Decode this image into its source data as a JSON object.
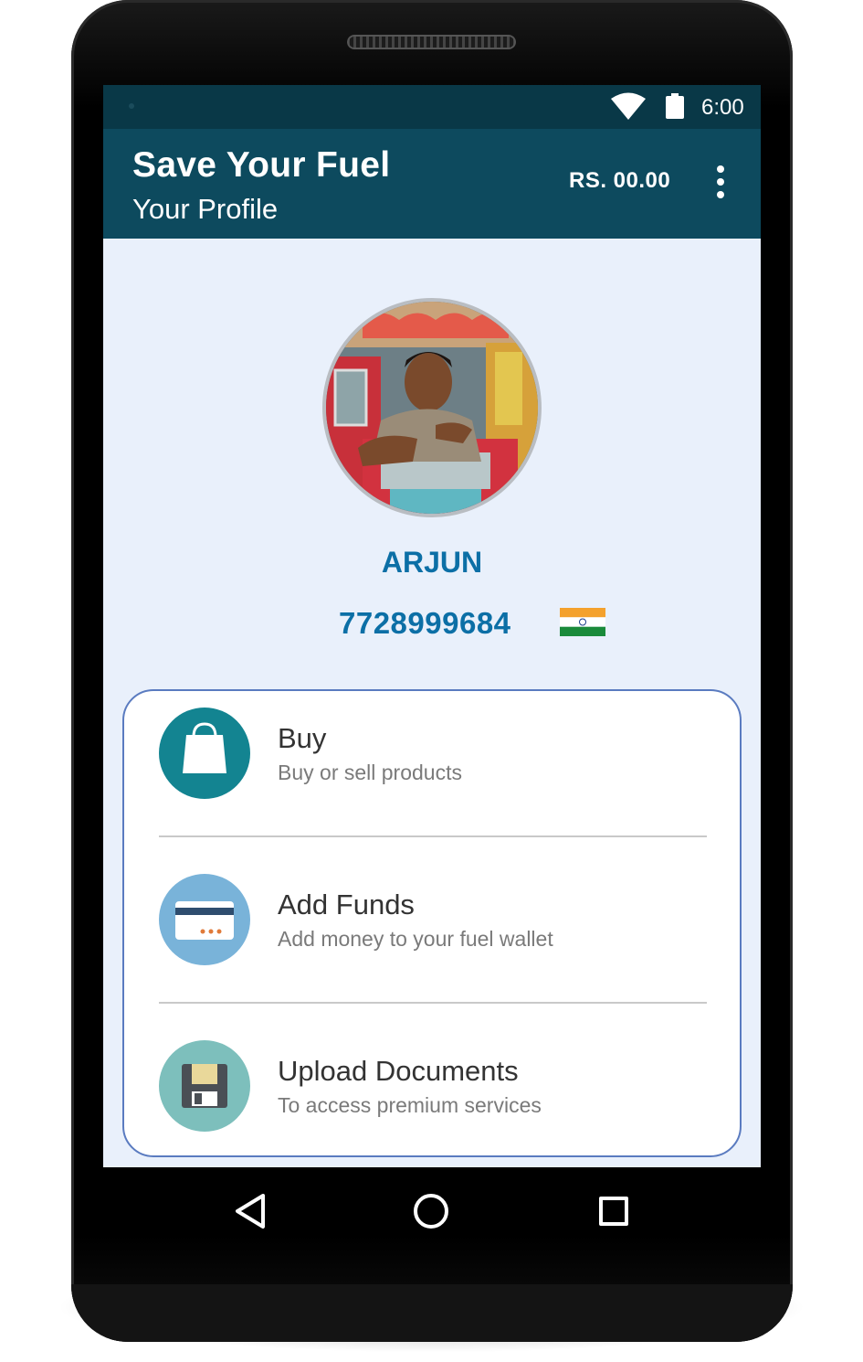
{
  "status_bar": {
    "time": "6:00"
  },
  "app_bar": {
    "title": "Save Your Fuel",
    "subtitle": "Your Profile",
    "balance": "RS. 00.00"
  },
  "profile": {
    "name": "ARJUN",
    "phone": "7728999684"
  },
  "menu": {
    "items": [
      {
        "title": "Buy",
        "subtitle": "Buy or sell products",
        "icon": "shopping-bag-icon",
        "color": "#138491"
      },
      {
        "title": "Add Funds",
        "subtitle": "Add money to your fuel wallet",
        "icon": "credit-card-icon",
        "color": "#79b3d9"
      },
      {
        "title": "Upload Documents",
        "subtitle": "To access premium services",
        "icon": "floppy-disk-icon",
        "color": "#7dbfbc"
      }
    ]
  },
  "colors": {
    "status_bar": "#093847",
    "app_bar": "#0d4a5e",
    "accent_text": "#0c6fa6",
    "screen_bg": "#e9f0fb",
    "card_border": "#5a7bc0"
  }
}
